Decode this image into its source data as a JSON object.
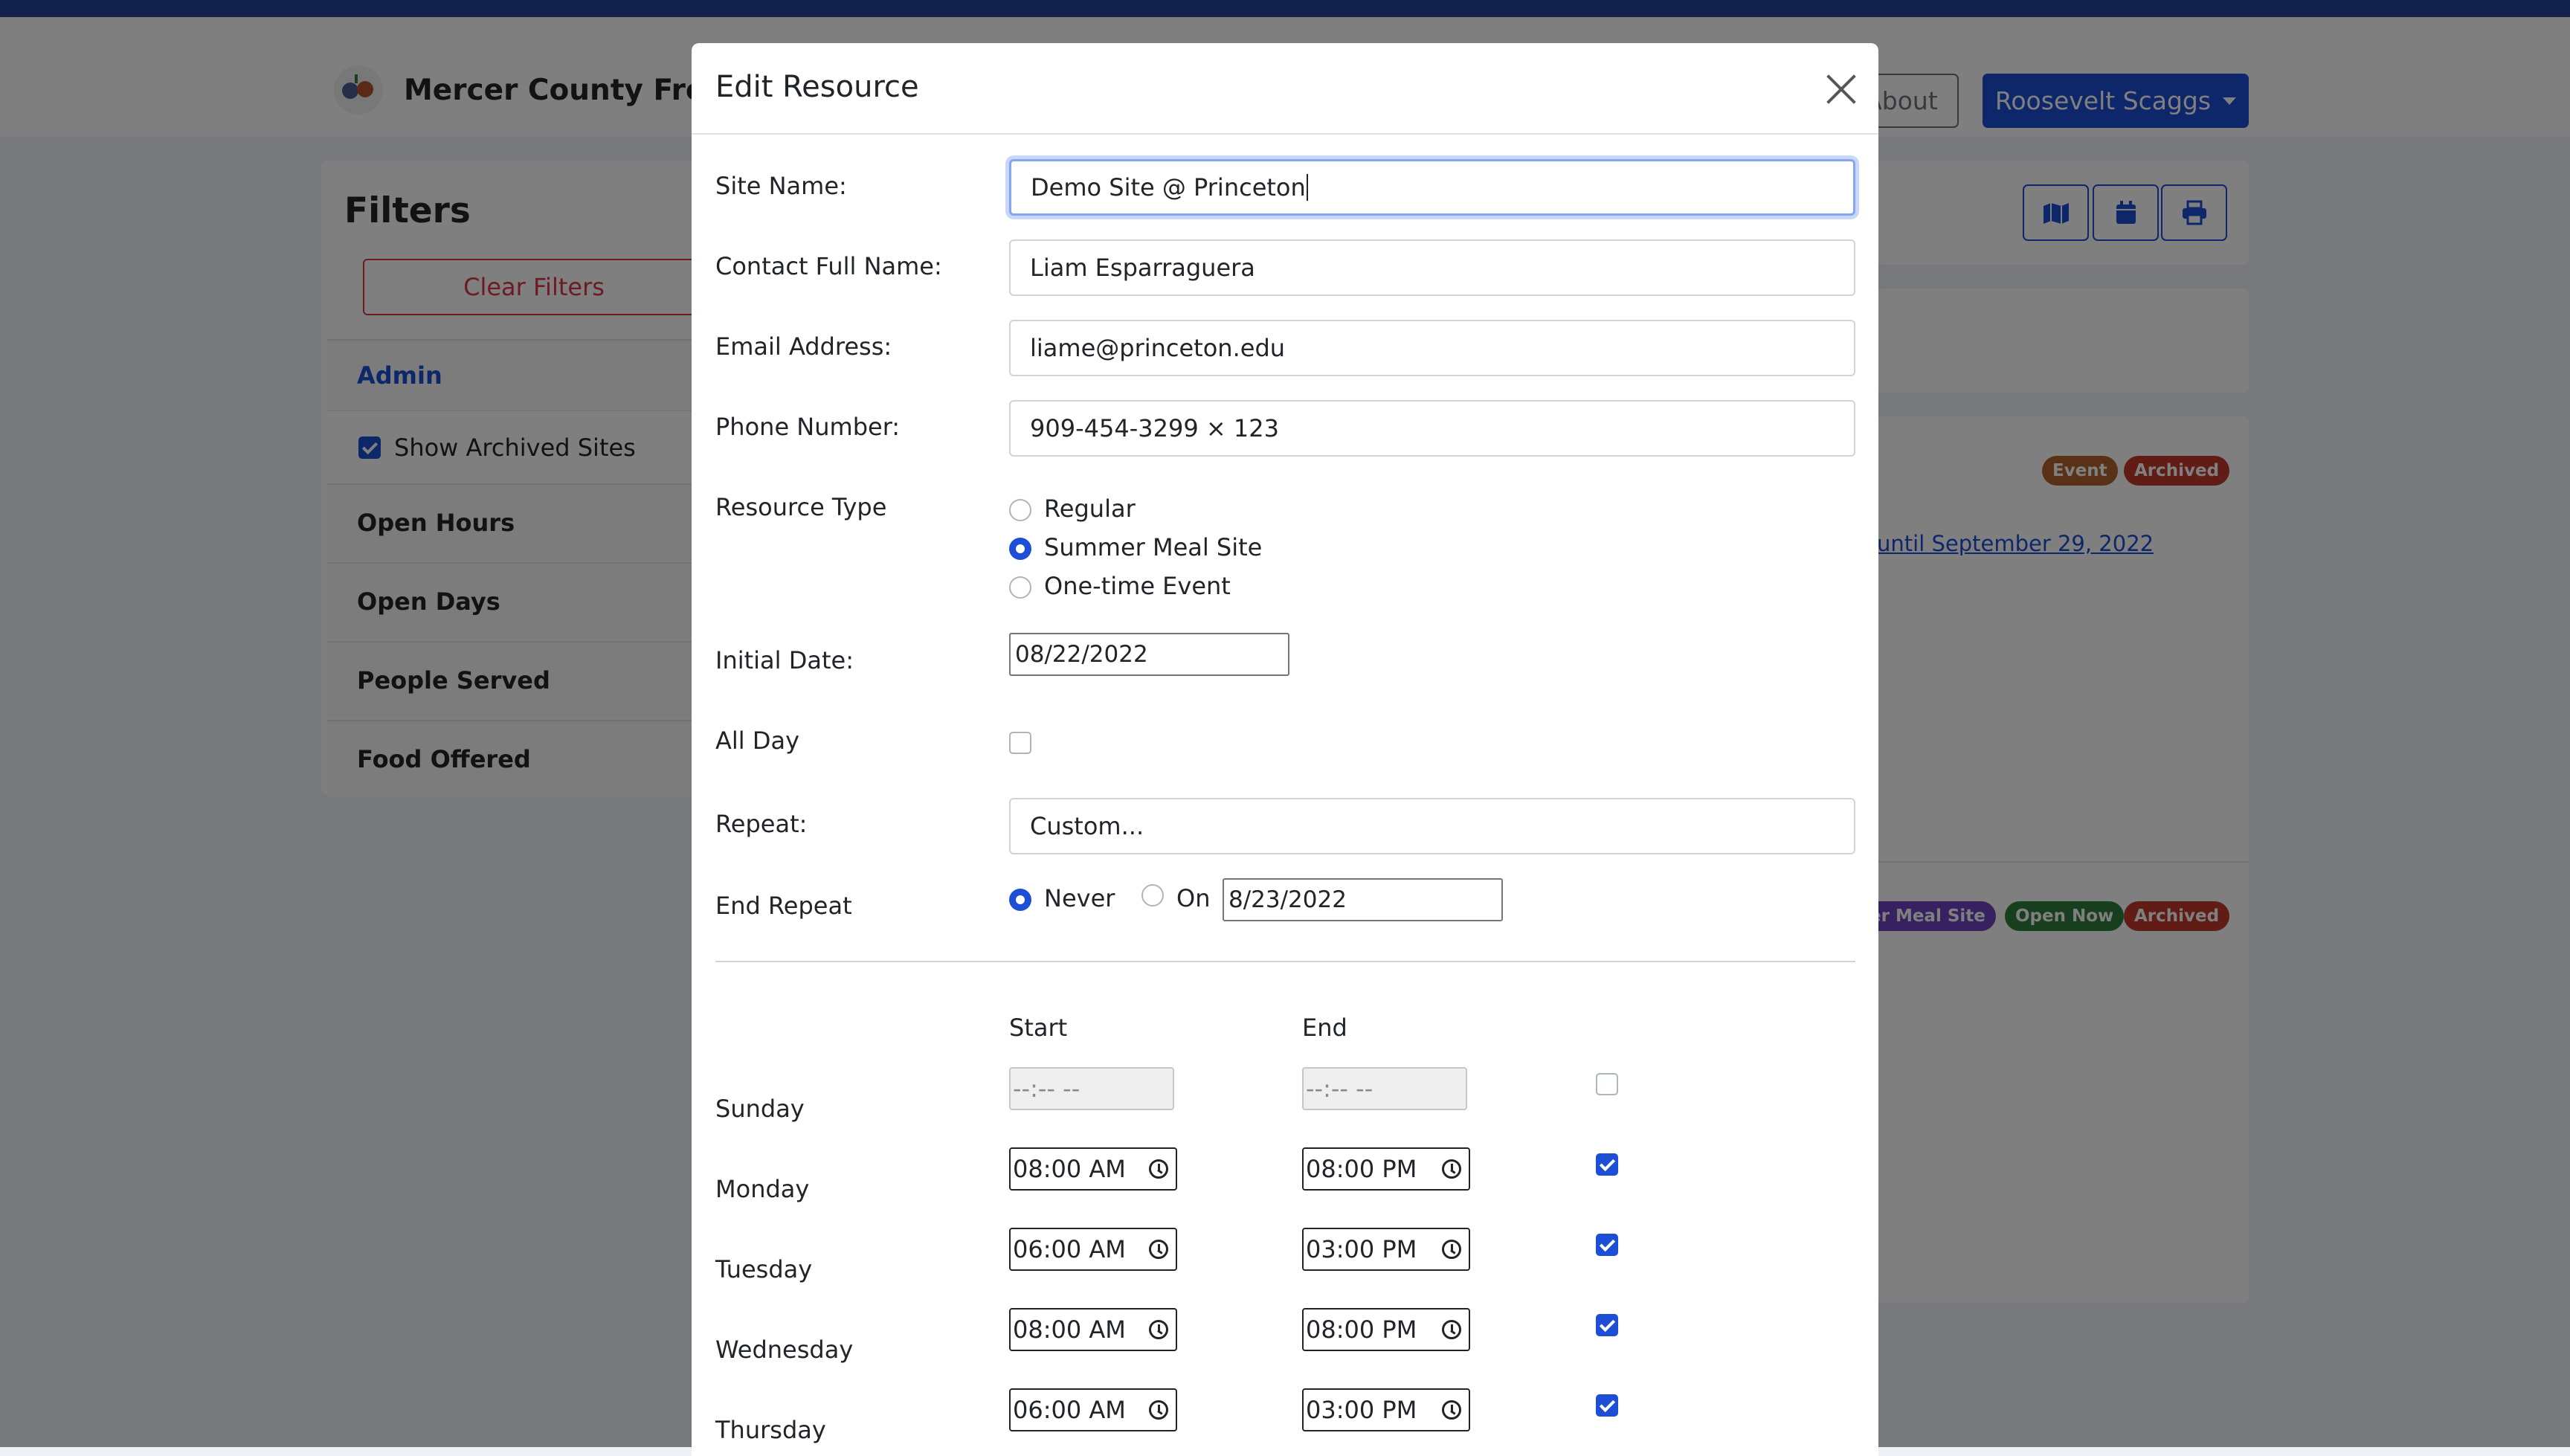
{
  "app": {
    "brand": "Mercer County Free",
    "nav_about": "About",
    "user_name": "Roosevelt Scaggs"
  },
  "sidebar": {
    "title": "Filters",
    "clear_filters": "Clear Filters",
    "admin": "Admin",
    "show_archived": "Show Archived Sites",
    "show_archived_checked": true,
    "sections": [
      "Open Hours",
      "Open Days",
      "People Served",
      "Food Offered"
    ]
  },
  "results": {
    "toolbar_icons": [
      "map-icon",
      "calendar-icon",
      "print-icon"
    ],
    "card1_badges": [
      "Event",
      "Archived"
    ],
    "card1_link": "until September 29, 2022",
    "card2_badges": [
      "er Meal Site",
      "Open Now",
      "Archived"
    ],
    "colors": {
      "event": "#b3632f",
      "archived": "#c0392b",
      "meal": "#6f42c1",
      "open": "#2e7d3a",
      "primary": "#1c4fd6"
    }
  },
  "modal": {
    "title": "Edit Resource",
    "site_name_label": "Site Name:",
    "site_name_value": "Demo Site @ Princeton",
    "contact_label": "Contact Full Name:",
    "contact_value": "Liam Esparraguera",
    "email_label": "Email Address:",
    "email_value": "liame@princeton.edu",
    "phone_label": "Phone Number:",
    "phone_value": "909-454-3299 × 123",
    "resource_type_label": "Resource Type",
    "resource_types": [
      "Regular",
      "Summer Meal Site",
      "One-time Event"
    ],
    "resource_type_selected": "Summer Meal Site",
    "initial_date_label": "Initial Date:",
    "initial_date_value": "08/22/2022",
    "all_day_label": "All Day",
    "all_day_checked": false,
    "repeat_label": "Repeat:",
    "repeat_value": "Custom...",
    "end_repeat_label": "End Repeat",
    "end_repeat_never": "Never",
    "end_repeat_on": "On",
    "end_repeat_selected": "Never",
    "end_repeat_date": "8/23/2022",
    "start_header": "Start",
    "end_header": "End",
    "time_placeholder": "--:-- --",
    "days": [
      {
        "name": "Sunday",
        "start": "",
        "end": "",
        "enabled": false
      },
      {
        "name": "Monday",
        "start": "08:00 AM",
        "end": "08:00 PM",
        "enabled": true
      },
      {
        "name": "Tuesday",
        "start": "06:00 AM",
        "end": "03:00 PM",
        "enabled": true
      },
      {
        "name": "Wednesday",
        "start": "08:00 AM",
        "end": "08:00 PM",
        "enabled": true
      },
      {
        "name": "Thursday",
        "start": "06:00 AM",
        "end": "03:00 PM",
        "enabled": true
      }
    ]
  }
}
